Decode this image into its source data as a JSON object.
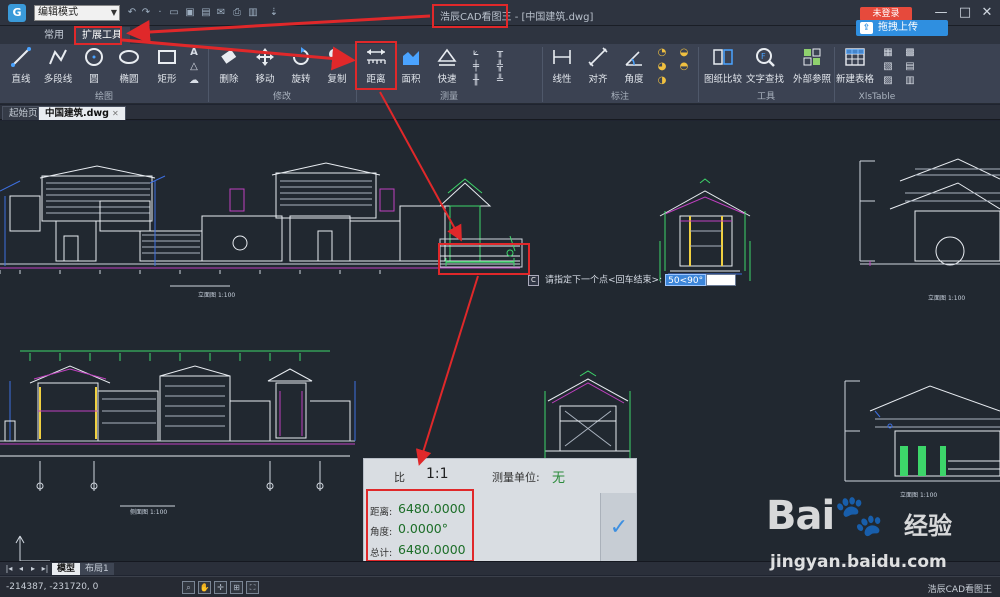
{
  "titlebar": {
    "mode": "编辑模式",
    "title": "浩辰CAD看图王 - [中国建筑.dwg]",
    "login": "未登录",
    "minimize": "—",
    "maximize": "□",
    "close": "✕"
  },
  "tabs": [
    {
      "label": "常用"
    },
    {
      "label": "扩展工具"
    }
  ],
  "upload": {
    "label": "拖拽上传"
  },
  "ribbon": {
    "draw": {
      "group": "绘图",
      "line": "直线",
      "polyline": "多段线",
      "circle": "圆",
      "ellipse": "椭圆",
      "rect": "矩形",
      "text": "A"
    },
    "modify": {
      "group": "修改",
      "erase": "删除",
      "move": "移动",
      "rotate": "旋转",
      "copy": "复制"
    },
    "measure": {
      "group": "测量",
      "distance": "距离",
      "area": "面积",
      "quick": "快速"
    },
    "annotate": {
      "group": "标注",
      "linear": "线性",
      "aligned": "对齐",
      "angle": "角度"
    },
    "tools": {
      "group": "工具",
      "compare": "图纸比较",
      "findtext": "文字查找",
      "xref": "外部参照"
    },
    "xlstable": {
      "group": "XlsTable",
      "newtable": "新建表格"
    }
  },
  "doctabs": {
    "start": "起始页",
    "file": "中国建筑.dwg"
  },
  "drawing_labels": {
    "elev1": "立面图",
    "elev1_scale": "1:100",
    "elev2": "立面图",
    "elev2_scale": "1:100",
    "side": "侧面图",
    "side_scale": "1:100",
    "elev3": "立面图",
    "elev3_scale": "1:100"
  },
  "command": {
    "prompt": "请指定下一个点<回车结束>:",
    "value": "50<90°"
  },
  "measure_panel": {
    "scale_label": "比",
    "scale_value": "1:1",
    "unit_label": "测量单位:",
    "unit_value": "无",
    "distance_label": "距离:",
    "distance_value": "6480.0000",
    "angle_label": "角度:",
    "angle_value": "0.0000°",
    "total_label": "总计:",
    "total_value": "6480.0000",
    "confirm": "✓"
  },
  "layout_tabs": {
    "model": "模型",
    "layout1": "布局1"
  },
  "status": {
    "coords": "-214387, -231720, 0",
    "app": "浩辰CAD看图王"
  },
  "watermark": {
    "brand": "Bai🐾",
    "sub": "经验",
    "url": "jingyan.baidu.com"
  },
  "colors": {
    "accent_red": "#e0282a",
    "canvas_bg": "#212830",
    "upload_blue": "#2f8fe0"
  }
}
